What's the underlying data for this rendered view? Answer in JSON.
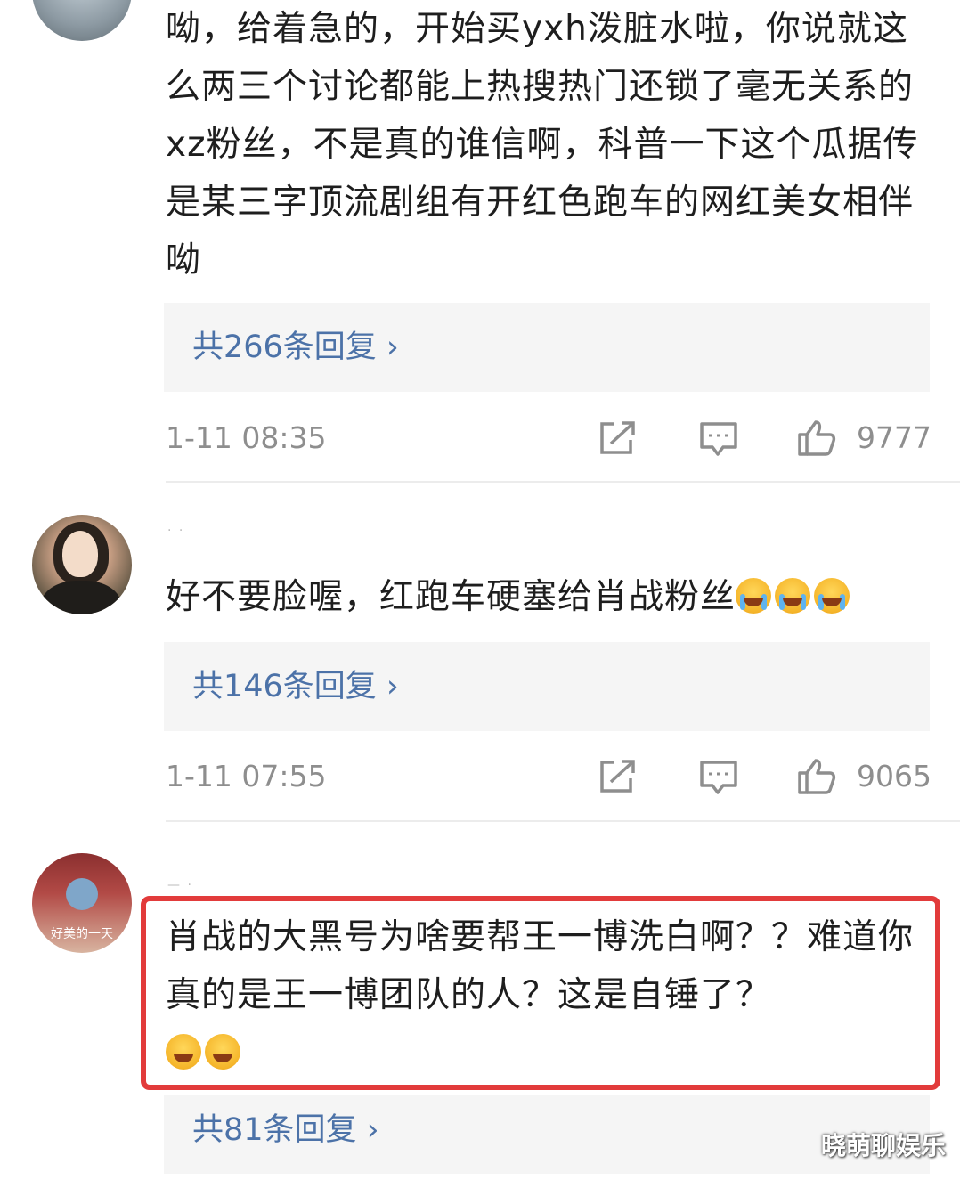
{
  "comments": [
    {
      "username": "",
      "text": "呦，给着急的，开始买yxh泼脏水啦，你说就这么两三个讨论都能上热搜热门还锁了毫无关系的xz粉丝，不是真的谁信啊，科普一下这个瓜据传是某三字顶流剧组有开红色跑车的网红美女相伴呦",
      "replies_label": "共266条回复 ›",
      "time": "1-11 08:35",
      "likes": "9777"
    },
    {
      "username": "·  ·",
      "text": "好不要脸喔，红跑车硬塞给肖战粉丝",
      "emoji_count": 3,
      "replies_label": "共146条回复 ›",
      "time": "1-11 07:55",
      "likes": "9065"
    },
    {
      "username": "— ·",
      "text": "肖战的大黑号为啥要帮王一博洗白啊？？难道你真的是王一博团队的人？这是自锤了？",
      "emoji_count": 2,
      "avatar_text": "好美的一天",
      "replies_label": "共81条回复 ›"
    }
  ],
  "watermark": "晓萌聊娱乐",
  "colors": {
    "link": "#4c72a8",
    "highlight_border": "#e23b3b",
    "meta_text": "#8e8e8e"
  },
  "icons": {
    "share": "share-icon",
    "comment": "comment-icon",
    "like": "thumbs-up-icon"
  }
}
